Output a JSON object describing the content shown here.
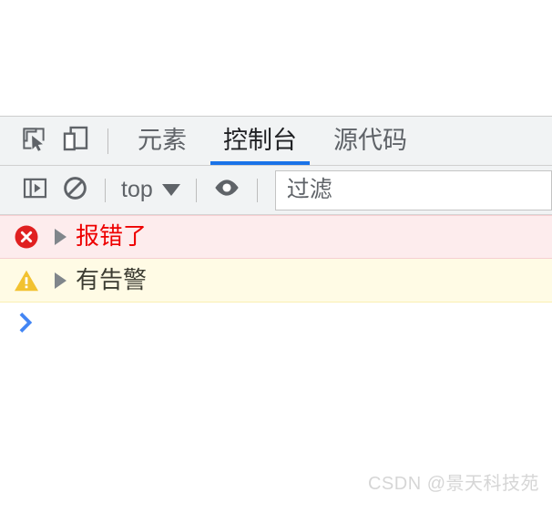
{
  "window": {
    "title": "DevTools Console"
  },
  "tabbar": {
    "inspect_icon": "inspect-element-icon",
    "device_icon": "device-toolbar-icon",
    "tabs": [
      {
        "label": "元素",
        "active": false
      },
      {
        "label": "控制台",
        "active": true
      },
      {
        "label": "源代码",
        "active": false
      }
    ]
  },
  "toolbar": {
    "sidebar_icon": "show-console-sidebar-icon",
    "clear_icon": "clear-console-icon",
    "context": {
      "label": "top",
      "caret": "chevron-down-icon"
    },
    "eye_icon": "live-expression-eye-icon",
    "filter": {
      "value": "",
      "placeholder": "过滤"
    }
  },
  "console": {
    "messages": [
      {
        "severity": "error",
        "icon": "error-circle-icon",
        "disclosure": "expand-triangle-icon",
        "text": "报错了"
      },
      {
        "severity": "warning",
        "icon": "warning-triangle-icon",
        "disclosure": "expand-triangle-icon",
        "text": "有告警"
      }
    ],
    "prompt": {
      "chevron": "›",
      "value": ""
    }
  },
  "watermark": {
    "text": "CSDN @景天科技苑"
  },
  "colors": {
    "accent_blue": "#1a73e8",
    "prompt_blue": "#4285f4",
    "error_red": "#ee0000",
    "error_icon_red": "#e02020",
    "error_bg": "#fdeced",
    "warning_yellow": "#f2c230",
    "warning_bg": "#fffbe5",
    "toolbar_bg": "#f1f3f4",
    "icon_gray": "#5f6368"
  }
}
